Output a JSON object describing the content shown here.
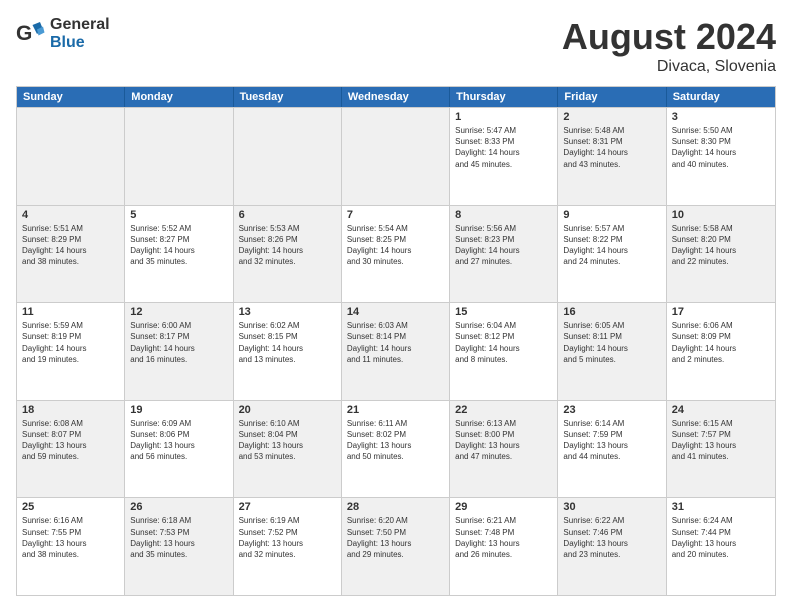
{
  "header": {
    "logo_general": "General",
    "logo_blue": "Blue",
    "month_title": "August 2024",
    "location": "Divaca, Slovenia"
  },
  "weekdays": [
    "Sunday",
    "Monday",
    "Tuesday",
    "Wednesday",
    "Thursday",
    "Friday",
    "Saturday"
  ],
  "rows": [
    [
      {
        "day": "",
        "info": "",
        "shaded": true
      },
      {
        "day": "",
        "info": "",
        "shaded": true
      },
      {
        "day": "",
        "info": "",
        "shaded": true
      },
      {
        "day": "",
        "info": "",
        "shaded": true
      },
      {
        "day": "1",
        "info": "Sunrise: 5:47 AM\nSunset: 8:33 PM\nDaylight: 14 hours\nand 45 minutes.",
        "shaded": false
      },
      {
        "day": "2",
        "info": "Sunrise: 5:48 AM\nSunset: 8:31 PM\nDaylight: 14 hours\nand 43 minutes.",
        "shaded": true
      },
      {
        "day": "3",
        "info": "Sunrise: 5:50 AM\nSunset: 8:30 PM\nDaylight: 14 hours\nand 40 minutes.",
        "shaded": false
      }
    ],
    [
      {
        "day": "4",
        "info": "Sunrise: 5:51 AM\nSunset: 8:29 PM\nDaylight: 14 hours\nand 38 minutes.",
        "shaded": true
      },
      {
        "day": "5",
        "info": "Sunrise: 5:52 AM\nSunset: 8:27 PM\nDaylight: 14 hours\nand 35 minutes.",
        "shaded": false
      },
      {
        "day": "6",
        "info": "Sunrise: 5:53 AM\nSunset: 8:26 PM\nDaylight: 14 hours\nand 32 minutes.",
        "shaded": true
      },
      {
        "day": "7",
        "info": "Sunrise: 5:54 AM\nSunset: 8:25 PM\nDaylight: 14 hours\nand 30 minutes.",
        "shaded": false
      },
      {
        "day": "8",
        "info": "Sunrise: 5:56 AM\nSunset: 8:23 PM\nDaylight: 14 hours\nand 27 minutes.",
        "shaded": true
      },
      {
        "day": "9",
        "info": "Sunrise: 5:57 AM\nSunset: 8:22 PM\nDaylight: 14 hours\nand 24 minutes.",
        "shaded": false
      },
      {
        "day": "10",
        "info": "Sunrise: 5:58 AM\nSunset: 8:20 PM\nDaylight: 14 hours\nand 22 minutes.",
        "shaded": true
      }
    ],
    [
      {
        "day": "11",
        "info": "Sunrise: 5:59 AM\nSunset: 8:19 PM\nDaylight: 14 hours\nand 19 minutes.",
        "shaded": false
      },
      {
        "day": "12",
        "info": "Sunrise: 6:00 AM\nSunset: 8:17 PM\nDaylight: 14 hours\nand 16 minutes.",
        "shaded": true
      },
      {
        "day": "13",
        "info": "Sunrise: 6:02 AM\nSunset: 8:15 PM\nDaylight: 14 hours\nand 13 minutes.",
        "shaded": false
      },
      {
        "day": "14",
        "info": "Sunrise: 6:03 AM\nSunset: 8:14 PM\nDaylight: 14 hours\nand 11 minutes.",
        "shaded": true
      },
      {
        "day": "15",
        "info": "Sunrise: 6:04 AM\nSunset: 8:12 PM\nDaylight: 14 hours\nand 8 minutes.",
        "shaded": false
      },
      {
        "day": "16",
        "info": "Sunrise: 6:05 AM\nSunset: 8:11 PM\nDaylight: 14 hours\nand 5 minutes.",
        "shaded": true
      },
      {
        "day": "17",
        "info": "Sunrise: 6:06 AM\nSunset: 8:09 PM\nDaylight: 14 hours\nand 2 minutes.",
        "shaded": false
      }
    ],
    [
      {
        "day": "18",
        "info": "Sunrise: 6:08 AM\nSunset: 8:07 PM\nDaylight: 13 hours\nand 59 minutes.",
        "shaded": true
      },
      {
        "day": "19",
        "info": "Sunrise: 6:09 AM\nSunset: 8:06 PM\nDaylight: 13 hours\nand 56 minutes.",
        "shaded": false
      },
      {
        "day": "20",
        "info": "Sunrise: 6:10 AM\nSunset: 8:04 PM\nDaylight: 13 hours\nand 53 minutes.",
        "shaded": true
      },
      {
        "day": "21",
        "info": "Sunrise: 6:11 AM\nSunset: 8:02 PM\nDaylight: 13 hours\nand 50 minutes.",
        "shaded": false
      },
      {
        "day": "22",
        "info": "Sunrise: 6:13 AM\nSunset: 8:00 PM\nDaylight: 13 hours\nand 47 minutes.",
        "shaded": true
      },
      {
        "day": "23",
        "info": "Sunrise: 6:14 AM\nSunset: 7:59 PM\nDaylight: 13 hours\nand 44 minutes.",
        "shaded": false
      },
      {
        "day": "24",
        "info": "Sunrise: 6:15 AM\nSunset: 7:57 PM\nDaylight: 13 hours\nand 41 minutes.",
        "shaded": true
      }
    ],
    [
      {
        "day": "25",
        "info": "Sunrise: 6:16 AM\nSunset: 7:55 PM\nDaylight: 13 hours\nand 38 minutes.",
        "shaded": false
      },
      {
        "day": "26",
        "info": "Sunrise: 6:18 AM\nSunset: 7:53 PM\nDaylight: 13 hours\nand 35 minutes.",
        "shaded": true
      },
      {
        "day": "27",
        "info": "Sunrise: 6:19 AM\nSunset: 7:52 PM\nDaylight: 13 hours\nand 32 minutes.",
        "shaded": false
      },
      {
        "day": "28",
        "info": "Sunrise: 6:20 AM\nSunset: 7:50 PM\nDaylight: 13 hours\nand 29 minutes.",
        "shaded": true
      },
      {
        "day": "29",
        "info": "Sunrise: 6:21 AM\nSunset: 7:48 PM\nDaylight: 13 hours\nand 26 minutes.",
        "shaded": false
      },
      {
        "day": "30",
        "info": "Sunrise: 6:22 AM\nSunset: 7:46 PM\nDaylight: 13 hours\nand 23 minutes.",
        "shaded": true
      },
      {
        "day": "31",
        "info": "Sunrise: 6:24 AM\nSunset: 7:44 PM\nDaylight: 13 hours\nand 20 minutes.",
        "shaded": false
      }
    ]
  ]
}
